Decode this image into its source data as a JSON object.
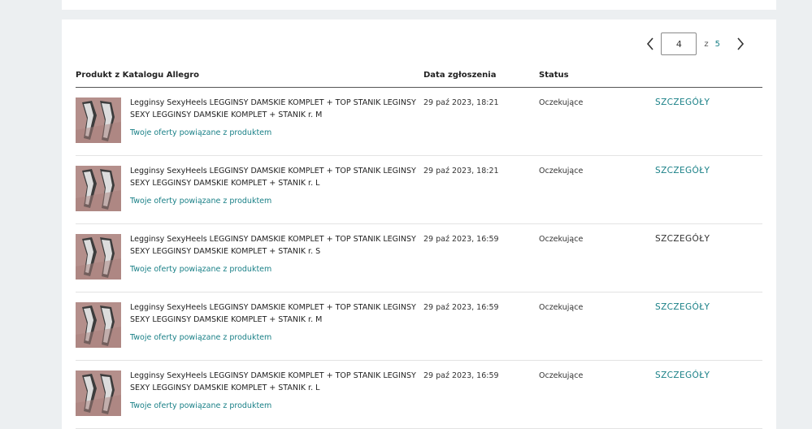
{
  "pagination": {
    "current_page": "4",
    "of_label": "z",
    "total_pages": "5",
    "prev_icon": "chevron-left-icon",
    "next_icon": "chevron-right-icon"
  },
  "table": {
    "headers": {
      "product": "Produkt z Katalogu Allegro",
      "date": "Data zgłoszenia",
      "status": "Status"
    },
    "rows": [
      {
        "title": "Legginsy SexyHeels LEGGINSY DAMSKIE KOMPLET + TOP STANIK LEGINSY SEXY LEGGINSY DAMSKIE KOMPLET + STANIK r. M",
        "offers_link": "Twoje oferty powiązane z produktem",
        "date": "29 paź 2023, 18:21",
        "status": "Oczekujące",
        "details": "SZCZEGÓŁY"
      },
      {
        "title": "Legginsy SexyHeels LEGGINSY DAMSKIE KOMPLET + TOP STANIK LEGINSY SEXY LEGGINSY DAMSKIE KOMPLET + STANIK r. L",
        "offers_link": "Twoje oferty powiązane z produktem",
        "date": "29 paź 2023, 18:21",
        "status": "Oczekujące",
        "details": "SZCZEGÓŁY"
      },
      {
        "title": "Legginsy SexyHeels LEGGINSY DAMSKIE KOMPLET + TOP STANIK LEGINSY SEXY LEGGINSY DAMSKIE KOMPLET + STANIK r. S",
        "offers_link": "Twoje oferty powiązane z produktem",
        "date": "29 paź 2023, 16:59",
        "status": "Oczekujące",
        "details": "SZCZEGÓŁY"
      },
      {
        "title": "Legginsy SexyHeels LEGGINSY DAMSKIE KOMPLET + TOP STANIK LEGINSY SEXY LEGGINSY DAMSKIE KOMPLET + STANIK r. M",
        "offers_link": "Twoje oferty powiązane z produktem",
        "date": "29 paź 2023, 16:59",
        "status": "Oczekujące",
        "details": "SZCZEGÓŁY"
      },
      {
        "title": "Legginsy SexyHeels LEGGINSY DAMSKIE KOMPLET + TOP STANIK LEGINSY SEXY LEGGINSY DAMSKIE KOMPLET + STANIK r. L",
        "offers_link": "Twoje oferty powiązane z produktem",
        "date": "29 paź 2023, 16:59",
        "status": "Oczekujące",
        "details": "SZCZEGÓŁY"
      }
    ]
  },
  "colors": {
    "accent": "#1a8087",
    "page_background": "#eceff1",
    "card_background": "#ffffff"
  }
}
